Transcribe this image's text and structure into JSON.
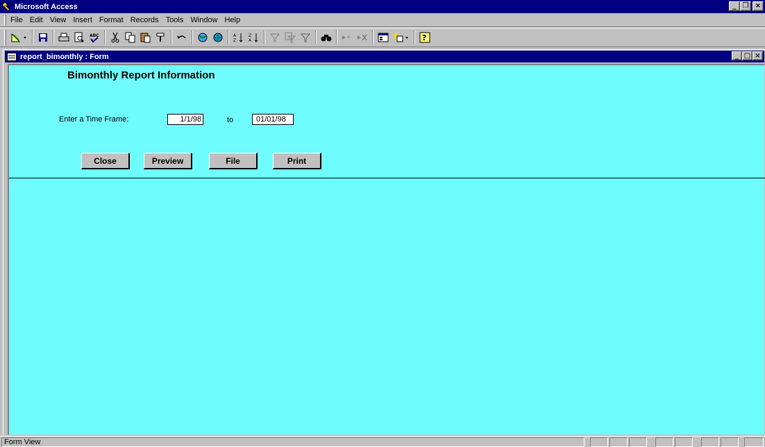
{
  "app": {
    "title": "Microsoft Access",
    "icon": "access-key-icon"
  },
  "window_controls": {
    "minimize": "_",
    "restore": "❐",
    "close": "×"
  },
  "menu": {
    "items": [
      {
        "label": "File"
      },
      {
        "label": "Edit"
      },
      {
        "label": "View"
      },
      {
        "label": "Insert"
      },
      {
        "label": "Format"
      },
      {
        "label": "Records"
      },
      {
        "label": "Tools"
      },
      {
        "label": "Window"
      },
      {
        "label": "Help"
      }
    ]
  },
  "toolbar": {
    "buttons": [
      {
        "name": "design-view-icon",
        "glyph": "📐"
      },
      {
        "name": "save-icon",
        "glyph": "💾"
      },
      {
        "name": "print-icon",
        "glyph": "🖶"
      },
      {
        "name": "print-preview-icon",
        "glyph": "🔍"
      },
      {
        "name": "spelling-icon",
        "glyph": "ABC"
      },
      {
        "name": "cut-icon",
        "glyph": "✂"
      },
      {
        "name": "copy-icon",
        "glyph": "⎘"
      },
      {
        "name": "paste-icon",
        "glyph": "📋"
      },
      {
        "name": "format-painter-icon",
        "glyph": "🖌"
      },
      {
        "name": "undo-icon",
        "glyph": "↶"
      },
      {
        "name": "insert-hyperlink-icon",
        "glyph": "🌐"
      },
      {
        "name": "web-toolbar-icon",
        "glyph": "🌍"
      },
      {
        "name": "sort-ascending-icon",
        "glyph": "A↓"
      },
      {
        "name": "sort-descending-icon",
        "glyph": "Z↓"
      },
      {
        "name": "filter-by-selection-icon",
        "glyph": "⛛"
      },
      {
        "name": "filter-by-form-icon",
        "glyph": "⛛"
      },
      {
        "name": "apply-filter-icon",
        "glyph": "▽"
      },
      {
        "name": "find-icon",
        "glyph": "🔭"
      },
      {
        "name": "new-record-icon",
        "glyph": "▸*"
      },
      {
        "name": "delete-record-icon",
        "glyph": "▸✕"
      },
      {
        "name": "database-window-icon",
        "glyph": "🗔"
      },
      {
        "name": "new-object-icon",
        "glyph": "✚"
      },
      {
        "name": "help-icon",
        "glyph": "?"
      }
    ]
  },
  "form_window": {
    "title": "report_bimonthly : Form",
    "heading": "Bimonthly Report Information",
    "timeframe_label": "Enter a Time Frame:",
    "date_from": "1/1/98",
    "to_label": "to",
    "date_to": "01/01/98",
    "buttons": {
      "close": "Close",
      "preview": "Preview",
      "file": "File",
      "print": "Print"
    },
    "background_color": "#6ffcfe"
  },
  "status": {
    "text": "Form View"
  }
}
